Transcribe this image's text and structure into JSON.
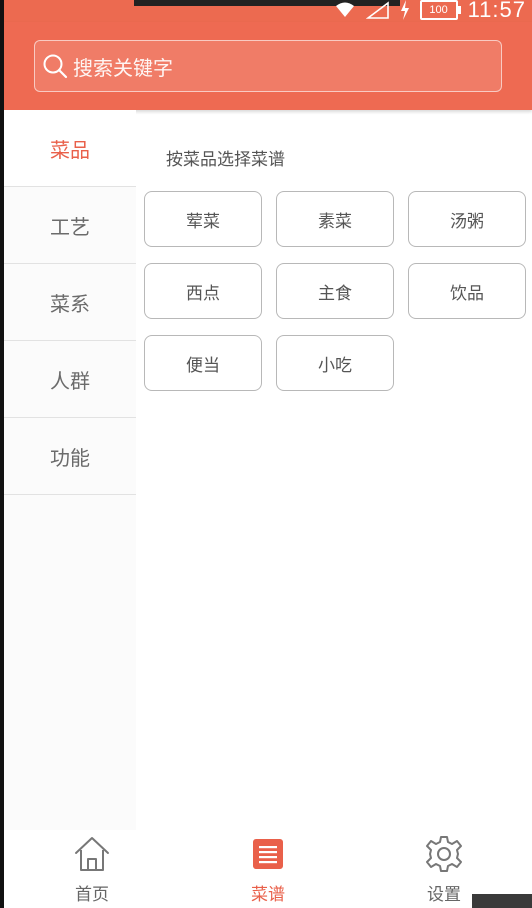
{
  "status_bar": {
    "time": "11:57",
    "battery": "100",
    "icons": [
      "wifi-icon",
      "signal-icon",
      "charging-icon",
      "battery-icon"
    ]
  },
  "search": {
    "placeholder": "搜索关键字",
    "icon": "search-icon"
  },
  "sidebar": {
    "items": [
      {
        "label": "菜品",
        "active": true
      },
      {
        "label": "工艺",
        "active": false
      },
      {
        "label": "菜系",
        "active": false
      },
      {
        "label": "人群",
        "active": false
      },
      {
        "label": "功能",
        "active": false
      }
    ]
  },
  "main": {
    "section_title": "按菜品选择菜谱",
    "tags": [
      "荤菜",
      "素菜",
      "汤粥",
      "西点",
      "主食",
      "饮品",
      "便当",
      "小吃"
    ]
  },
  "bottom_nav": {
    "items": [
      {
        "label": "首页",
        "icon": "home-icon",
        "active": false
      },
      {
        "label": "菜谱",
        "icon": "recipe-list-icon",
        "active": true
      },
      {
        "label": "设置",
        "icon": "gear-icon",
        "active": false
      }
    ]
  },
  "colors": {
    "accent": "#ee6a52",
    "active_text": "#e9604a",
    "text": "#555555",
    "border": "#b8b8b8"
  }
}
